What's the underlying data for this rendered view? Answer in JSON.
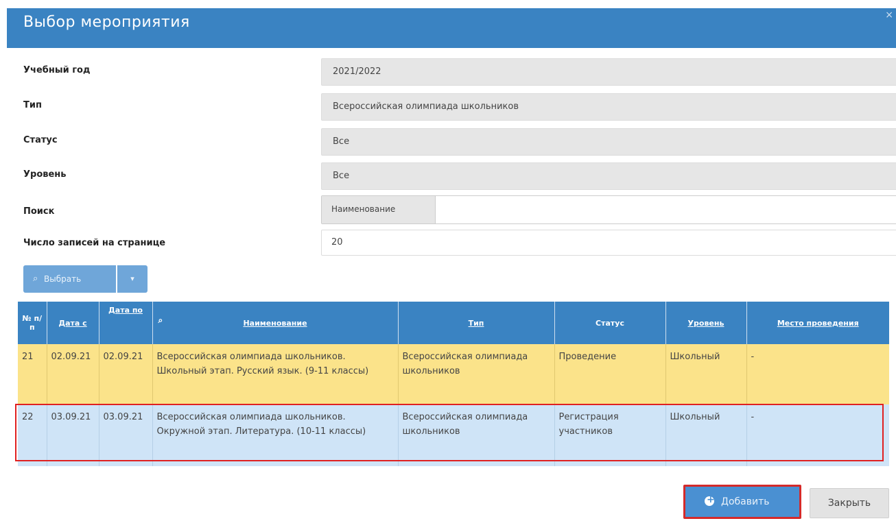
{
  "dialog": {
    "title": "Выбор мероприятия"
  },
  "filters": {
    "year_label": "Учебный год",
    "year_value": "2021/2022",
    "type_label": "Тип",
    "type_value": "Всероссийская олимпиада школьников",
    "status_label": "Статус",
    "status_value": "Все",
    "level_label": "Уровень",
    "level_value": "Все",
    "search_label": "Поиск",
    "search_addon": "Наименование",
    "search_value": "",
    "perpage_label": "Число записей на странице",
    "perpage_value": "20"
  },
  "select_button": {
    "label": "Выбрать"
  },
  "table": {
    "headers": {
      "num": "№ п/п",
      "date_from": "Дата с",
      "date_to": "Дата по",
      "name": "Наименование",
      "type": "Тип",
      "status": "Статус",
      "level": "Уровень",
      "place": "Место проведения"
    },
    "rows": [
      {
        "num": "21",
        "date_from": "02.09.21",
        "date_to": "02.09.21",
        "name": "Всероссийская олимпиада школьников. Школьный этап. Русский язык. (9-11 классы)",
        "type": "Всероссийская олимпиада школьников",
        "status": "Проведение",
        "level": "Школьный",
        "place": "-"
      },
      {
        "num": "22",
        "date_from": "03.09.21",
        "date_to": "03.09.21",
        "name": "Всероссийская олимпиада школьников. Окружной этап. Литература. (10-11 классы)",
        "type": "Всероссийская олимпиада школьников",
        "status": "Регистрация участников",
        "level": "Школьный",
        "place": "-"
      }
    ]
  },
  "footer": {
    "add_label": "Добавить",
    "close_label": "Закрыть"
  },
  "colors": {
    "header_blue": "#3a83c2",
    "row_yellow": "#fbe38a",
    "row_blue": "#cfe4f7",
    "highlight_red": "#e02020"
  }
}
